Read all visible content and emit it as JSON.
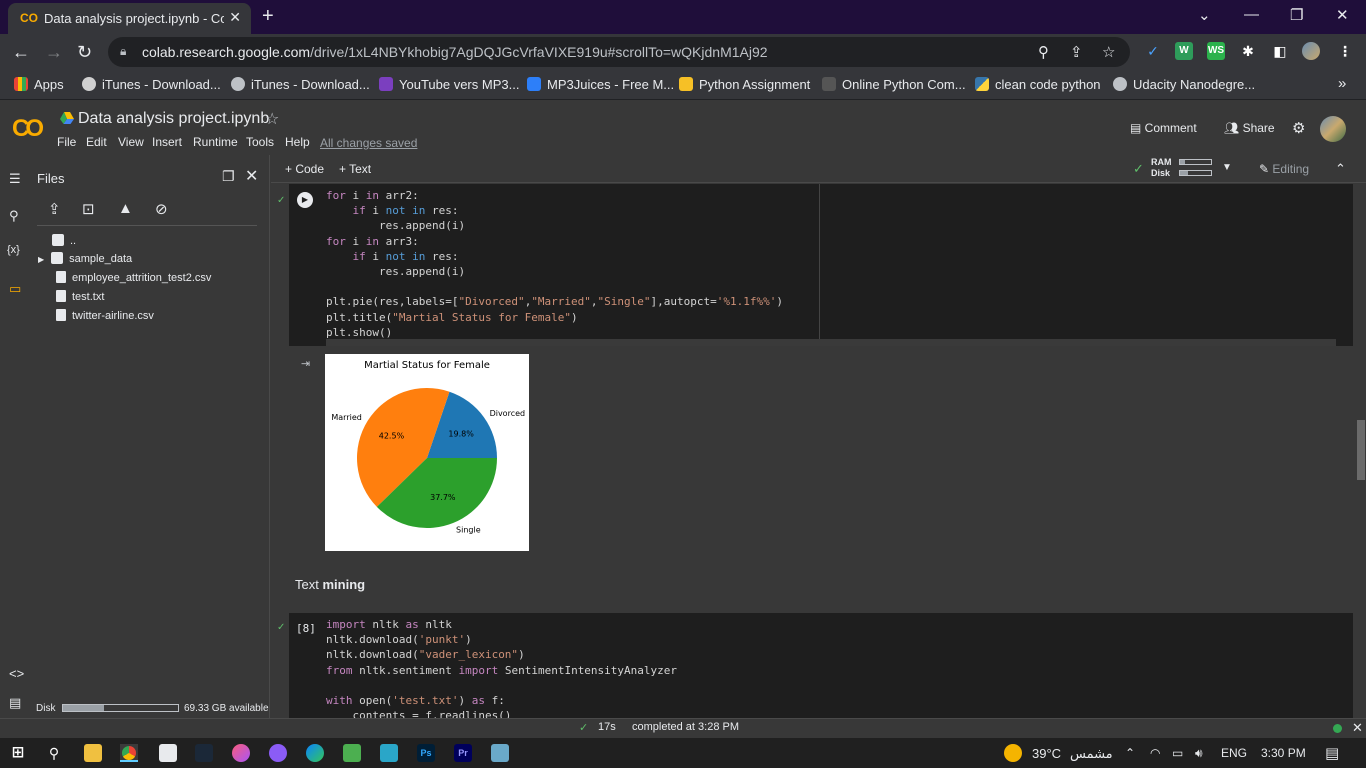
{
  "browser": {
    "tab_title": "Data analysis project.ipynb - Cola",
    "tab_favicon": "CO",
    "url_host": "colab.research.google.com",
    "url_path": "/drive/1xL4NBYkhobig7AgDQJGcVrfaVIXE919u#scrollTo=wQKjdnM1Aj92",
    "bookmarks": [
      "Apps",
      "iTunes - Download...",
      "iTunes - Download...",
      "YouTube vers MP3...",
      "MP3Juices - Free M...",
      "Python Assignment",
      "Online Python Com...",
      "clean code python",
      "Udacity Nanodegre..."
    ],
    "bookmarks_more": "»"
  },
  "colab": {
    "notebook_title": "Data analysis project.ipynb",
    "menus": [
      "File",
      "Edit",
      "View",
      "Insert",
      "Runtime",
      "Tools",
      "Help"
    ],
    "saved_status": "All changes saved",
    "comment_label": "Comment",
    "share_label": "Share",
    "add_code": "+ Code",
    "add_text": "+ Text",
    "ram_label": "RAM",
    "disk_label": "Disk",
    "ram_fraction": 0.15,
    "disk_fraction": 0.25,
    "editing_label": "Editing"
  },
  "files_panel": {
    "title": "Files",
    "items": [
      {
        "name": "..",
        "type": "parent-folder"
      },
      {
        "name": "sample_data",
        "type": "folder"
      },
      {
        "name": "employee_attrition_test2.csv",
        "type": "file"
      },
      {
        "name": "test.txt",
        "type": "file"
      },
      {
        "name": "twitter-airline.csv",
        "type": "file"
      }
    ],
    "disk_label": "Disk",
    "disk_available": "69.33 GB available",
    "disk_used_fraction": 0.36
  },
  "cells": {
    "cell1_code": "for i in arr2:\n    if i not in res:\n        res.append(i)\nfor i in arr3:\n    if i not in res:\n        res.append(i)\n\nplt.pie(res,labels=[\"Divorced\",\"Married\",\"Single\"],autopct='%1.1f%%')\nplt.title(\"Martial Status for Female\")\nplt.show()",
    "text_cell_prefix": "Text ",
    "text_cell_bold": "mining",
    "cell2_exec": "[8]",
    "cell2_code": "import nltk as nltk\nnltk.download('punkt')\nnltk.download(\"vader_lexicon\")\nfrom nltk.sentiment import SentimentIntensityAnalyzer\n\nwith open('test.txt') as f:\n    contents = f.readlines()"
  },
  "chart_data": {
    "type": "pie",
    "title": "Martial Status for Female",
    "categories": [
      "Divorced",
      "Married",
      "Single"
    ],
    "values": [
      19.8,
      42.5,
      37.7
    ],
    "labels_pct": [
      "19.8%",
      "42.5%",
      "37.7%"
    ],
    "colors": [
      "#1f77b4",
      "#ff7f0e",
      "#2ca02c"
    ]
  },
  "status": {
    "elapsed": "17s",
    "completed": "completed at 3:28 PM"
  },
  "taskbar": {
    "temperature": "39°C",
    "weather_text": "مشمس",
    "language": "ENG",
    "time": "3:30 PM"
  }
}
